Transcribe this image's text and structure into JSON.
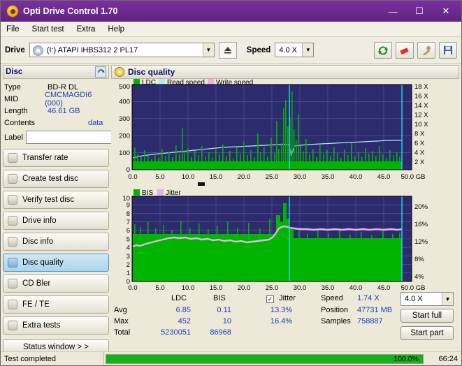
{
  "window": {
    "title": "Opti Drive Control 1.70",
    "minimize": "—",
    "maximize": "☐",
    "close": "✕"
  },
  "menu": [
    "File",
    "Start test",
    "Extra",
    "Help"
  ],
  "drivebar": {
    "drive_label": "Drive",
    "drive_value": "(I:)  ATAPI iHBS312   2 PL17",
    "eject_icon": "eject-icon",
    "speed_label": "Speed",
    "speed_value": "4.0 X",
    "tools": [
      "refresh-icon",
      "eraser-icon",
      "tools-icon",
      "save-icon"
    ]
  },
  "disc_panel": {
    "title": "Disc",
    "refresh_icon": "refresh-icon",
    "rows": [
      {
        "key": "Type",
        "value": "BD-R DL"
      },
      {
        "key": "MID",
        "value": "CMCMAGDI6 (000)"
      },
      {
        "key": "Length",
        "value": "46.61 GB"
      },
      {
        "key": "Contents",
        "value": "data"
      }
    ],
    "label_key": "Label",
    "label_value": "",
    "label_button_icon": "refresh-disc-icon"
  },
  "nav": {
    "items": [
      {
        "label": "Transfer rate",
        "icon": "transfer-rate-icon",
        "active": false
      },
      {
        "label": "Create test disc",
        "icon": "create-test-disc-icon",
        "active": false
      },
      {
        "label": "Verify test disc",
        "icon": "verify-test-disc-icon",
        "active": false
      },
      {
        "label": "Drive info",
        "icon": "drive-info-icon",
        "active": false
      },
      {
        "label": "Disc info",
        "icon": "disc-info-icon",
        "active": false
      },
      {
        "label": "Disc quality",
        "icon": "disc-quality-icon",
        "active": true
      },
      {
        "label": "CD Bler",
        "icon": "cd-bler-icon",
        "active": false
      },
      {
        "label": "FE / TE",
        "icon": "fe-te-icon",
        "active": false
      },
      {
        "label": "Extra tests",
        "icon": "extra-tests-icon",
        "active": false
      }
    ],
    "status_window": "Status window > >"
  },
  "main": {
    "title": "Disc quality",
    "icon": "disc-quality-icon"
  },
  "chart_data": [
    {
      "type": "line",
      "title": "LDC / Read speed / Write speed",
      "legend": [
        {
          "name": "LDC",
          "color": "#00b400"
        },
        {
          "name": "Read speed",
          "color": "#b7e8f0"
        },
        {
          "name": "Write speed",
          "color": "#f0b0e0"
        }
      ],
      "xlabel": "GB",
      "xticks": [
        "0.0",
        "5.0",
        "10.0",
        "15.0",
        "20.0",
        "25.0",
        "30.0",
        "35.0",
        "40.0",
        "45.0",
        "50.0 GB"
      ],
      "xlim": [
        0,
        50
      ],
      "ylabel": "LDC",
      "yticks": [
        "100",
        "200",
        "300",
        "400",
        "500"
      ],
      "ylim": [
        0,
        500
      ],
      "y2ticks": [
        "2 X",
        "4 X",
        "6 X",
        "8 X",
        "10 X",
        "12 X",
        "14 X",
        "16 X",
        "18 X"
      ],
      "y2lim": [
        0,
        18
      ],
      "grid": true
    },
    {
      "type": "line",
      "title": "BIS / Jitter",
      "legend": [
        {
          "name": "BIS",
          "color": "#00b400"
        },
        {
          "name": "Jitter",
          "color": "#e0b0e8"
        }
      ],
      "xlabel": "GB",
      "xticks": [
        "0.0",
        "5.0",
        "10.0",
        "15.0",
        "20.0",
        "25.0",
        "30.0",
        "35.0",
        "40.0",
        "45.0",
        "50.0 GB"
      ],
      "xlim": [
        0,
        50
      ],
      "ylabel": "BIS",
      "yticks": [
        "1",
        "2",
        "3",
        "4",
        "5",
        "6",
        "7",
        "8",
        "9",
        "10"
      ],
      "ylim": [
        0,
        10
      ],
      "y2ticks": [
        "4%",
        "8%",
        "12%",
        "16%",
        "20%"
      ],
      "y2lim": [
        0,
        20
      ],
      "grid": true
    }
  ],
  "stats": {
    "col_ldc": "LDC",
    "col_bis": "BIS",
    "rows": [
      {
        "label": "Avg",
        "ldc": "6.85",
        "bis": "0.11"
      },
      {
        "label": "Max",
        "ldc": "452",
        "bis": "10"
      },
      {
        "label": "Total",
        "ldc": "5230051",
        "bis": "86968"
      }
    ],
    "jitter_label": "Jitter",
    "jitter_checked": true,
    "jitter_avg": "13.3%",
    "jitter_max": "16.4%",
    "speed_label": "Speed",
    "speed_value": "1.74 X",
    "speed_combo": "4.0 X",
    "position_label": "Position",
    "position_value": "47731 MB",
    "samples_label": "Samples",
    "samples_value": "758887",
    "start_full": "Start full",
    "start_part": "Start part"
  },
  "statusbar": {
    "message": "Test completed",
    "progress_percent": "100.0%",
    "progress_value": 100,
    "elapsed": "66:24"
  }
}
